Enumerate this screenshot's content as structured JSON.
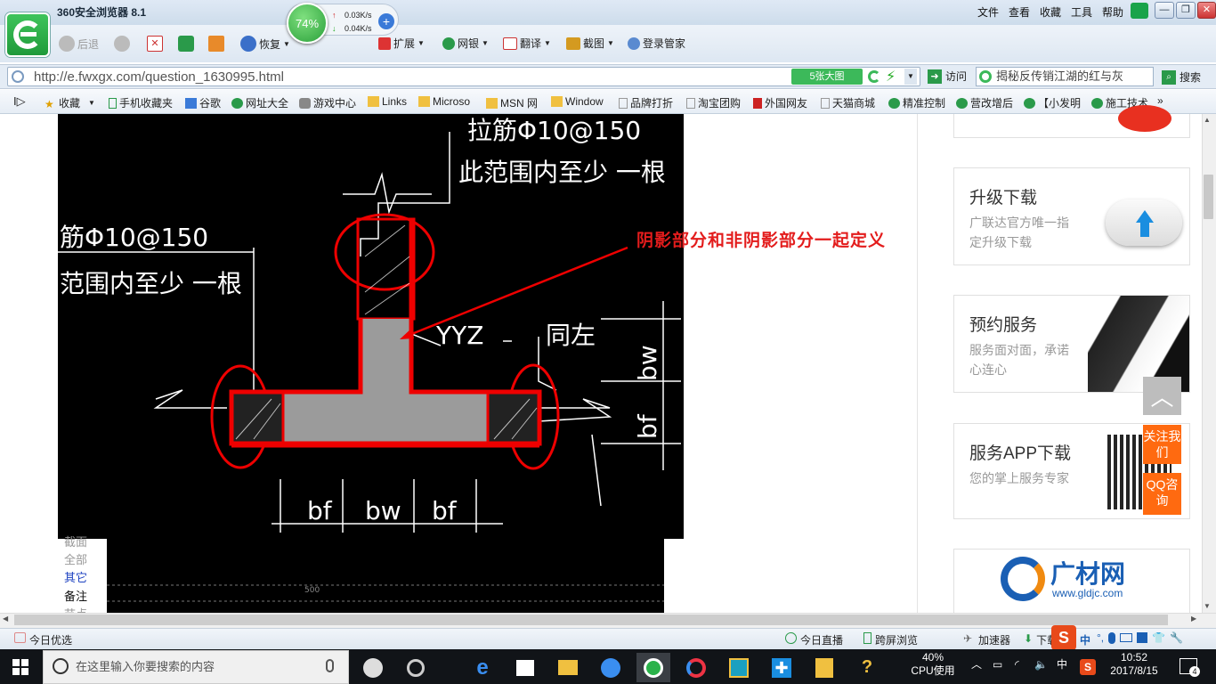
{
  "browser": {
    "title": "360安全浏览器 8.1",
    "menus": [
      "文件",
      "查看",
      "收藏",
      "工具",
      "帮助"
    ],
    "speed": {
      "percent": "74%",
      "up": "0.03K/s",
      "down": "0.04K/s"
    },
    "toolbar": {
      "back": "后退",
      "restore": "恢复",
      "extend": "扩展",
      "netbank": "网银",
      "translate": "翻译",
      "screenshot": "截图",
      "login": "登录管家"
    },
    "address": {
      "url": "http://e.fwxgx.com/question_1630995.html",
      "image_button": "5张大图",
      "visit": "访问",
      "search_text": "揭秘反传销江湖的红与灰",
      "search_button": "搜索"
    },
    "favorites": [
      "收藏",
      "手机收藏夹",
      "谷歌",
      "网址大全",
      "游戏中心",
      "Links",
      "Microso",
      "MSN 网",
      "Window",
      "品牌打折",
      "淘宝团购",
      "外国网友",
      "天猫商城",
      "精准控制",
      "营改增后",
      "【小发明",
      "施工技术"
    ]
  },
  "page": {
    "annotation": "阴影部分和非阴影部分一起定义",
    "cad_texts": {
      "top_right_1": "拉筋Φ10@150",
      "top_right_2": "此范围内至少    一根",
      "left_1": "筋Φ10@150",
      "left_2": "范围内至少    一根",
      "label_yyz": "YYZ",
      "label_same": "同左",
      "dim_bw_v": "bw",
      "dim_bf_v": "bf",
      "dim_bf1": "bf",
      "dim_bw": "bw",
      "dim_bf2": "bf",
      "small_num": "500"
    },
    "left_links": [
      "截面",
      "全部",
      "其它",
      "备注",
      "节点"
    ],
    "cards": [
      {
        "title": "升级下载",
        "desc": "广联达官方唯一指定升级下载"
      },
      {
        "title": "预约服务",
        "desc": "服务面对面，承诺心连心"
      },
      {
        "title": "服务APP下载",
        "desc": "您的掌上服务专家"
      }
    ],
    "follow": "关注我们",
    "qq": "QQ咨询",
    "brand": {
      "name": "广材网",
      "url": "www.gldjc.com"
    }
  },
  "statusbar": {
    "today": "今日优选",
    "live": "今日直播",
    "crossscreen": "跨屏浏览",
    "accelerator": "加速器",
    "download": "下载",
    "ime": "中"
  },
  "taskbar": {
    "search_placeholder": "在这里输入你要搜索的内容",
    "cpu_percent": "40%",
    "cpu_label": "CPU使用",
    "lang": "中",
    "time": "10:52",
    "date": "2017/8/15",
    "notifications": "4"
  },
  "colors": {
    "accent_red": "#e31c1c",
    "orange": "#ff6a10",
    "green": "#3cb95a"
  }
}
